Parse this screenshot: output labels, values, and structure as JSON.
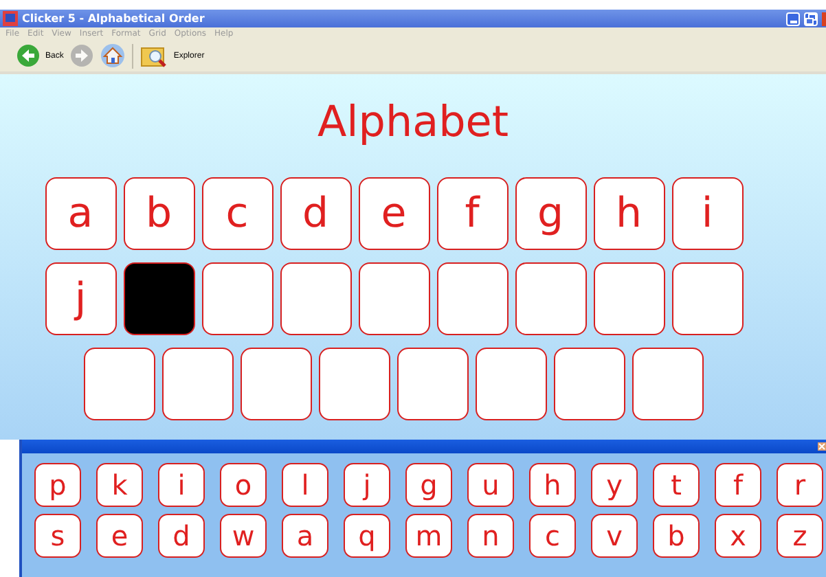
{
  "window": {
    "title": "Clicker 5 - Alphabetical Order"
  },
  "menu": [
    "File",
    "Edit",
    "View",
    "Insert",
    "Format",
    "Grid",
    "Options",
    "Help"
  ],
  "toolbar": [
    {
      "kind": "back",
      "label": "Back",
      "disabled": false
    },
    {
      "kind": "forward",
      "disabled": true
    },
    {
      "kind": "home",
      "disabled": false
    },
    {
      "kind": "explorer",
      "label": "Explorer",
      "disabled": false
    }
  ],
  "heading": "Alphabet",
  "grid": [
    [
      {
        "letter": "a",
        "selected": false
      },
      {
        "letter": "b",
        "selected": false
      },
      {
        "letter": "c",
        "selected": false
      },
      {
        "letter": "d",
        "selected": false
      },
      {
        "letter": "e",
        "selected": false
      },
      {
        "letter": "f",
        "selected": false
      },
      {
        "letter": "g",
        "selected": false
      },
      {
        "letter": "h",
        "selected": false
      },
      {
        "letter": "i",
        "selected": false
      }
    ],
    [
      {
        "letter": "j",
        "selected": false
      },
      {
        "selected": true
      },
      {
        "selected": false
      },
      {
        "selected": false
      },
      {
        "selected": false
      },
      {
        "selected": false
      },
      {
        "selected": false
      },
      {
        "selected": false
      },
      {
        "selected": false
      }
    ],
    [
      {
        "selected": false
      },
      {
        "selected": false
      },
      {
        "selected": false
      },
      {
        "selected": false
      },
      {
        "selected": false
      },
      {
        "selected": false
      },
      {
        "selected": false
      },
      {
        "selected": false
      }
    ]
  ],
  "keyboard": [
    [
      "p",
      "k",
      "i",
      "o",
      "l",
      "j",
      "g",
      "u",
      "h",
      "y",
      "t",
      "f",
      "r"
    ],
    [
      "s",
      "e",
      "d",
      "w",
      "a",
      "q",
      "m",
      "n",
      "c",
      "v",
      "b",
      "x",
      "z"
    ]
  ]
}
